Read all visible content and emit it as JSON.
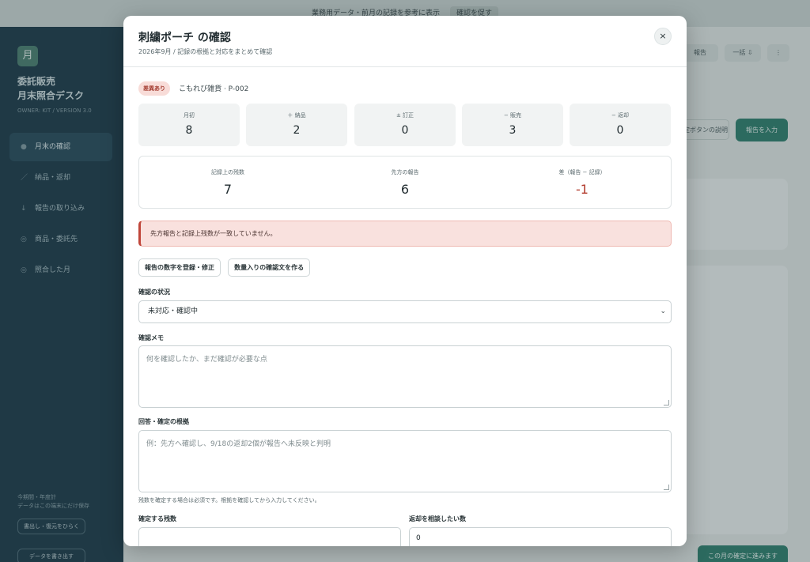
{
  "background": {
    "topbar_text": "業務用データ・前月の記録を参考に表示",
    "topbar_chip": "確認を促す",
    "logo_char": "月",
    "brand_line1": "委託販売",
    "brand_line2": "月末照合デスク",
    "brand_sub": "OWNER: KIT / VERSION 3.0",
    "nav": [
      {
        "label": "月末の確認",
        "icon": "●"
      },
      {
        "label": "納品・返却",
        "icon": "／"
      },
      {
        "label": "報告の取り込み",
        "icon": "↓"
      },
      {
        "label": "商品・委託先",
        "icon": "◎"
      },
      {
        "label": "照合した月",
        "icon": "◎"
      }
    ],
    "side_foot_line1": "今期間・年度計",
    "side_foot_line2": "データはこの端末にだけ保存",
    "side_btn1": "書出し・復元をひらく",
    "side_btn2": "データを書き出す",
    "header_btn1": "報告",
    "header_btn2": "一括 ⇩",
    "header_btn3": "⋮",
    "toolbar_btn1": "確定ボタンの説明",
    "primary_btn": "報告を入力",
    "bottom_primary": "この月の確定に進みます"
  },
  "modal": {
    "title": "刺繍ポーチ の確認",
    "subtitle": "2026年9月 / 記録の根拠と対応をまとめて確認",
    "close": "×",
    "badge": "差異あり",
    "item": "こもれび雑貨 · P-002",
    "stats": [
      {
        "label": "月初",
        "value": "8"
      },
      {
        "label": "＋ 納品",
        "value": "2"
      },
      {
        "label": "± 訂正",
        "value": "0"
      },
      {
        "label": "− 販売",
        "value": "3"
      },
      {
        "label": "− 返却",
        "value": "0"
      }
    ],
    "summary": [
      {
        "label": "記録上の残数",
        "value": "7"
      },
      {
        "label": "先方の報告",
        "value": "6"
      },
      {
        "label": "差（報告 − 記録）",
        "value": "-1"
      }
    ],
    "alert": "先方報告と記録上残数が一致していません。",
    "actions": [
      "報告の数字を登録・修正",
      "数量入りの確認文を作る"
    ],
    "status_label": "確認の状況",
    "status_value": "未対応・確認中",
    "memo_label": "確認メモ",
    "memo_placeholder": "何を確認したか、まだ確認が必要な点",
    "basis_label": "回答・確定の根拠",
    "basis_placeholder": "例：先方へ確認し、9/18の返却2個が報告へ未反映と判明",
    "hint": "残数を確定する場合は必須です。根拠を確認してから入力してください。",
    "confirm_label": "確定する残数",
    "confirm_value": "",
    "return_label": "返却を相談したい数",
    "return_value": "0"
  }
}
